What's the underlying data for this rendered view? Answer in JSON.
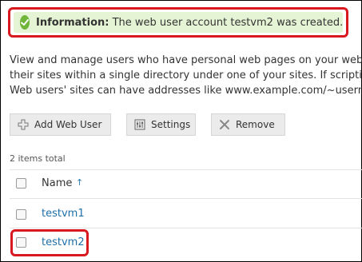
{
  "notice": {
    "label": "Information:",
    "message": "The web user account testvm2 was created."
  },
  "description": {
    "line1": "View and manage users who have personal web pages on your web",
    "line2": "their sites within a single directory under one of your sites. If scriptin",
    "line3": "Web users' sites can have addresses like www.example.com/~usern"
  },
  "toolbar": {
    "add_label": "Add Web User",
    "settings_label": "Settings",
    "remove_label": "Remove"
  },
  "list": {
    "total": "2 items total",
    "column_name": "Name",
    "sort_indicator": "↑",
    "rows": [
      {
        "name": "testvm1"
      },
      {
        "name": "testvm2"
      }
    ]
  },
  "colors": {
    "success_bg": "#e5f4d4",
    "success_icon": "#6fb63b",
    "highlight": "#d91820",
    "link": "#1f6fa8"
  }
}
